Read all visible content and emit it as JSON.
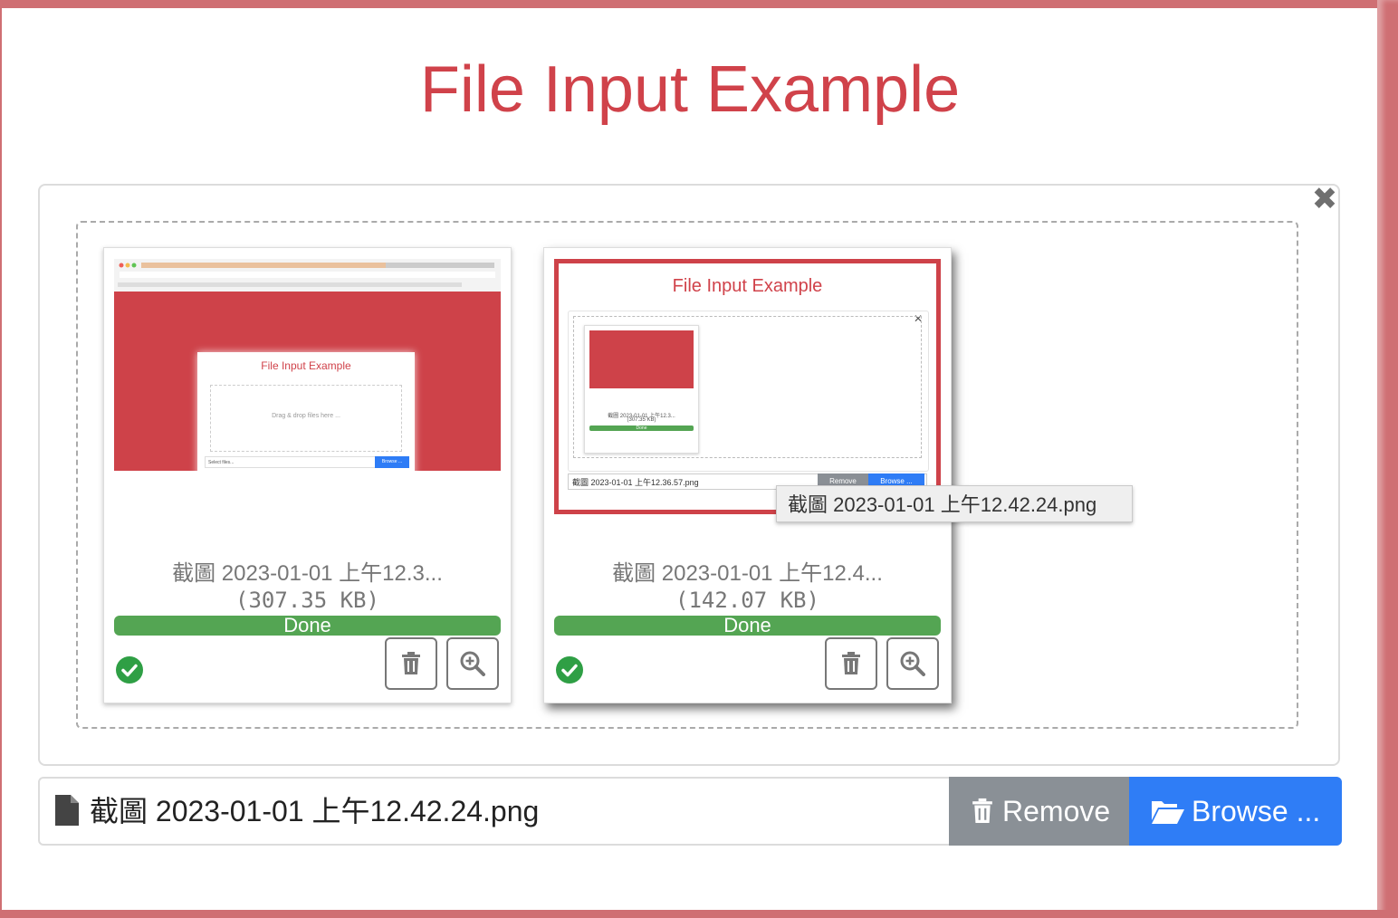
{
  "page": {
    "title": "File Input Example"
  },
  "colors": {
    "accent": "#d0424a",
    "frame": "#cf6f73",
    "success": "#54a553",
    "primary": "#2f7df6",
    "secondary": "#8a9096"
  },
  "preview": {
    "close_icon": "close-icon",
    "files": [
      {
        "caption": "截圖 2023-01-01 上午12.3...",
        "size": "(307.35 KB)",
        "status": "Done"
      },
      {
        "caption": "截圖 2023-01-01 上午12.4...",
        "size": "(142.07 KB)",
        "status": "Done"
      }
    ]
  },
  "thumb1": {
    "title": "File Input Example",
    "drop_text": "Drag & drop files here ...",
    "input_placeholder": "Select files...",
    "browse": "Browse ..."
  },
  "thumb2": {
    "title": "File Input Example",
    "card_caption": "截圖 2023-01-01 上午12.3...",
    "card_size": "(307.35 KB)",
    "card_status": "Done",
    "input_caption": "截圖 2023-01-01 上午12.36.57.png",
    "remove": "Remove",
    "browse": "Browse ..."
  },
  "tooltip": {
    "text": "截圖 2023-01-01 上午12.42.24.png"
  },
  "file_input": {
    "caption": "截圖 2023-01-01 上午12.42.24.png",
    "remove_label": "Remove",
    "browse_label": "Browse ..."
  }
}
